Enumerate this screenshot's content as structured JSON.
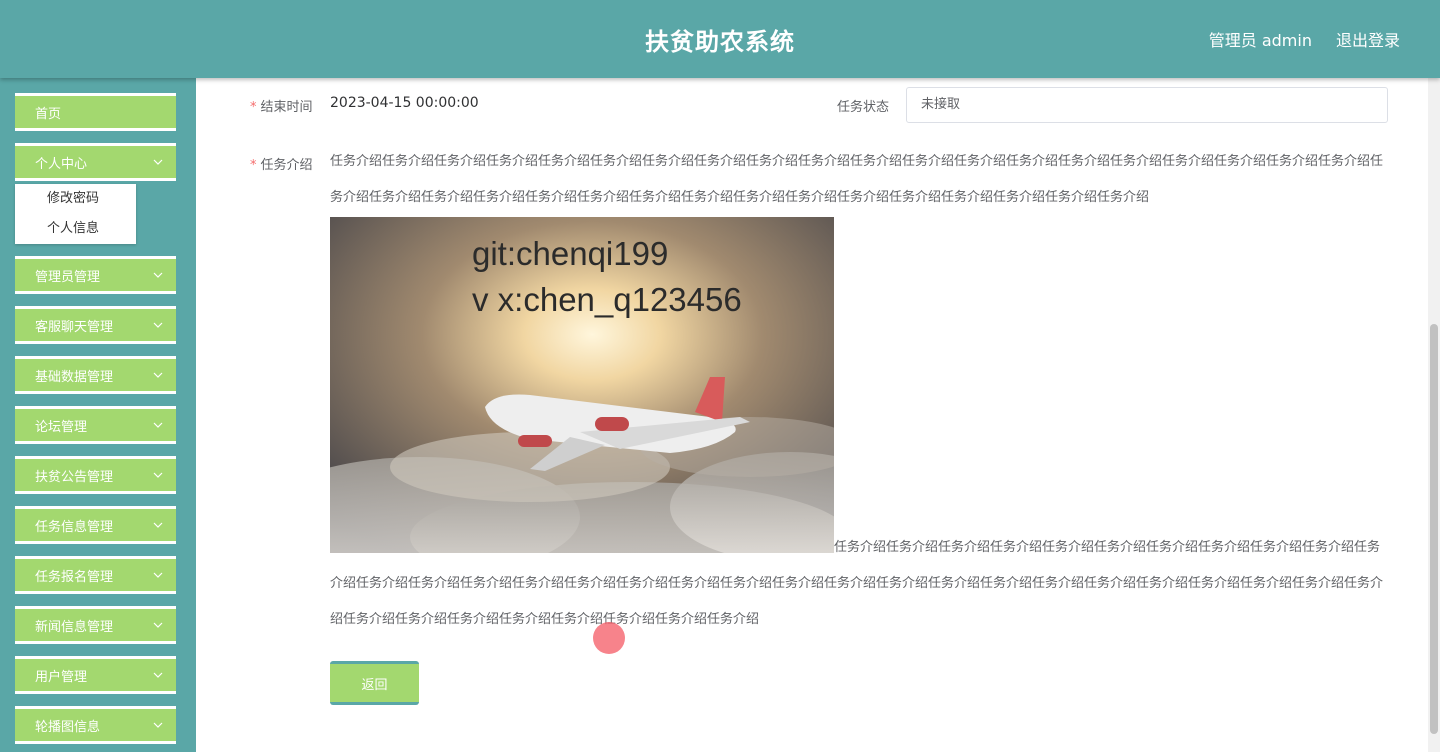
{
  "header": {
    "title": "扶贫助农系统",
    "user_label": "管理员 admin",
    "logout_label": "退出登录"
  },
  "sidebar": {
    "items": [
      {
        "label": "首页"
      },
      {
        "label": "个人中心"
      },
      {
        "label": "管理员管理"
      },
      {
        "label": "客服聊天管理"
      },
      {
        "label": "基础数据管理"
      },
      {
        "label": "论坛管理"
      },
      {
        "label": "扶贫公告管理"
      },
      {
        "label": "任务信息管理"
      },
      {
        "label": "任务报名管理"
      },
      {
        "label": "新闻信息管理"
      },
      {
        "label": "用户管理"
      },
      {
        "label": "轮播图信息"
      }
    ],
    "submenu": [
      {
        "label": "修改密码"
      },
      {
        "label": "个人信息"
      }
    ]
  },
  "form": {
    "end_time_label": "结束时间",
    "end_time_value": "2023-04-15 00:00:00",
    "status_label": "任务状态",
    "status_value": "未接取",
    "desc_label": "任务介绍",
    "desc_text_top": "任务介绍任务介绍任务介绍任务介绍任务介绍任务介绍任务介绍任务介绍任务介绍任务介绍任务介绍任务介绍任务介绍任务介绍任务介绍任务介绍任务介绍任务介绍任务介绍任务介绍任务介绍任务介绍任务介绍任务介绍任务介绍任务介绍任务介绍任务介绍任务介绍任务介绍任务介绍任务介绍任务介绍任务介绍任务介绍任务介绍",
    "desc_text_bottom": "任务介绍任务介绍任务介绍任务介绍任务介绍任务介绍任务介绍任务介绍任务介绍任务介绍任务介绍任务介绍任务介绍任务介绍任务介绍任务介绍任务介绍任务介绍任务介绍任务介绍任务介绍任务介绍任务介绍任务介绍任务介绍任务介绍任务介绍任务介绍任务介绍任务介绍任务介绍任务介绍任务介绍任务介绍任务介绍任务介绍任务介绍任务介绍任务介绍",
    "image_text_line1": "git:chenqi199",
    "image_text_line2": "v x:chen_q123456",
    "back_label": "返回"
  }
}
